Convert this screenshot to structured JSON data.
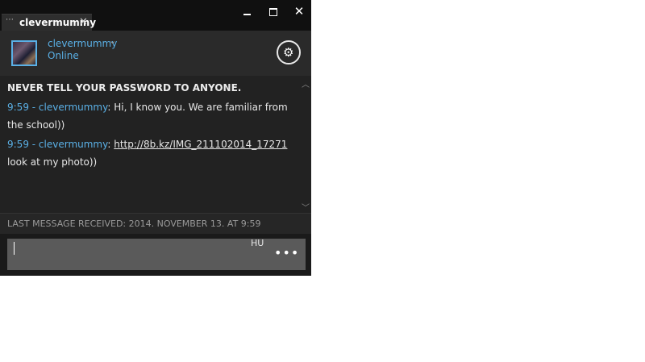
{
  "tab": {
    "grip": "⋯",
    "title": "clevermummy",
    "close": "✕"
  },
  "window_controls": {
    "close": "✕"
  },
  "header": {
    "contact_name": "clevermummy",
    "chevron": "⌄",
    "status": "Online",
    "settings_icon": "⚙"
  },
  "messages": {
    "warning": "NEVER TELL YOUR PASSWORD TO ANYONE.",
    "items": [
      {
        "time": "9:59",
        "sep": " - ",
        "sender": "clevermummy",
        "colon": ": ",
        "text": "Hi, I know you. We are familiar from the school))"
      },
      {
        "time": "9:59",
        "sep": " - ",
        "sender": "clevermummy",
        "colon": ": ",
        "link": "http://8b.kz/IMG_211102014_17271",
        "text": " look at my photo))"
      }
    ],
    "scroll_up": "︿",
    "scroll_down": "﹀"
  },
  "last_message": "LAST MESSAGE RECEIVED: 2014. NOVEMBER 13. AT 9:59",
  "composer": {
    "value": "",
    "language": "HU",
    "more": "•••"
  },
  "colors": {
    "accent": "#5ab0e6",
    "window_bg": "#1c1c1c",
    "input_bg": "#5a5a5a"
  }
}
